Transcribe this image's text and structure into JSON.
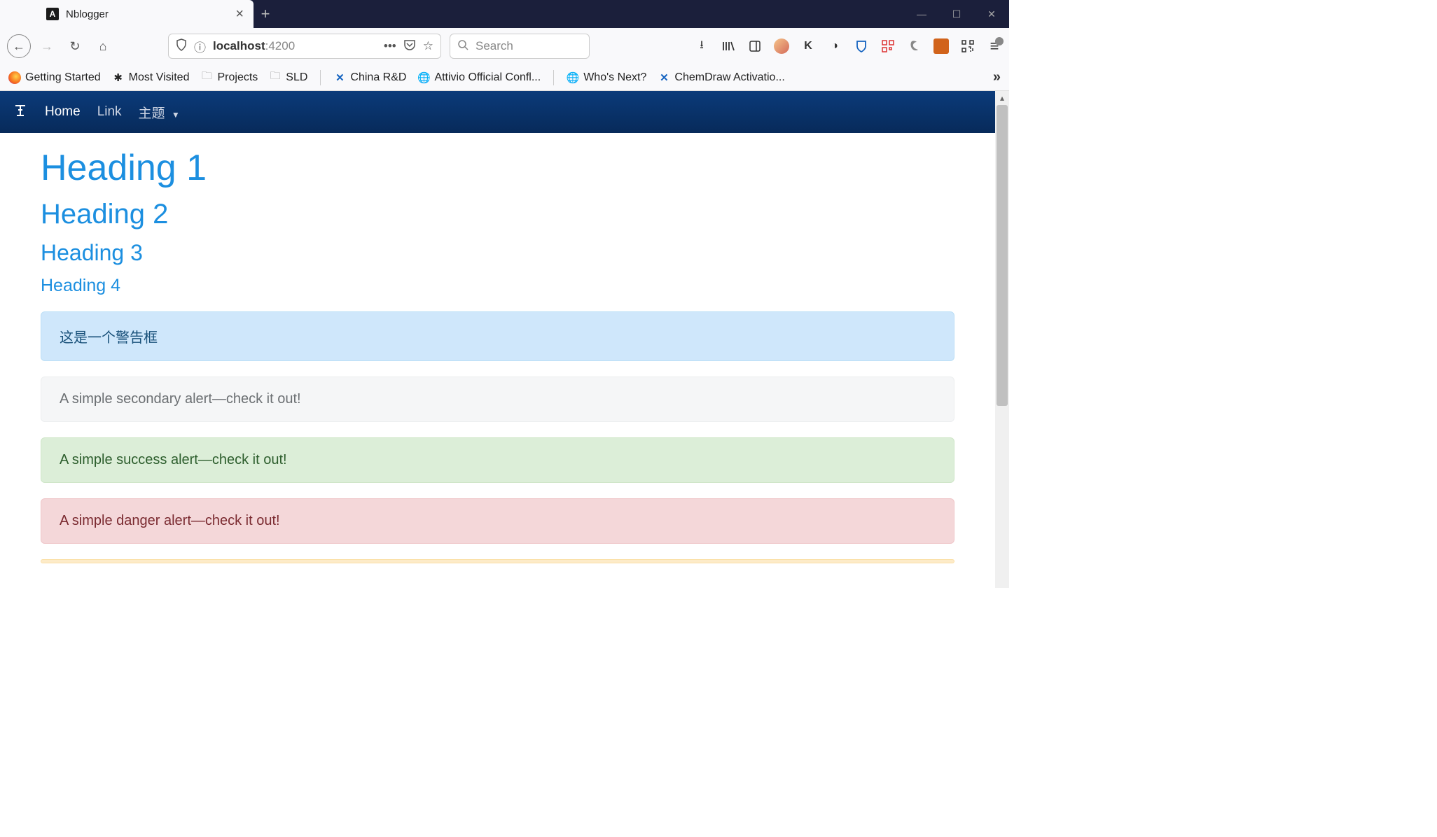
{
  "tab": {
    "title": "Nblogger",
    "favicon_letter": "A"
  },
  "window_controls": {
    "minimize": "—",
    "maximize": "☐",
    "close": "✕"
  },
  "toolbar": {
    "url_host": "localhost",
    "url_port": ":4200",
    "search_placeholder": "Search"
  },
  "bookmarks": [
    {
      "icon": "firefox",
      "label": "Getting Started"
    },
    {
      "icon": "gear",
      "label": "Most Visited"
    },
    {
      "icon": "folder",
      "label": "Projects"
    },
    {
      "icon": "folder",
      "label": "SLD"
    },
    {
      "icon": "confluence",
      "label": "China R&D",
      "sep_before": true
    },
    {
      "icon": "globe",
      "label": "Attivio Official Confl..."
    },
    {
      "icon": "globe",
      "label": "Who's Next?",
      "sep_before": true
    },
    {
      "icon": "confluence",
      "label": "ChemDraw Activatio..."
    }
  ],
  "app_nav": {
    "home": "Home",
    "link": "Link",
    "theme": "主题"
  },
  "headings": {
    "h1": "Heading 1",
    "h2": "Heading 2",
    "h3": "Heading 3",
    "h4": "Heading 4"
  },
  "alerts": {
    "primary": "这是一个警告框",
    "secondary": "A simple secondary alert—check it out!",
    "success": "A simple success alert—check it out!",
    "danger": "A simple danger alert—check it out!"
  }
}
